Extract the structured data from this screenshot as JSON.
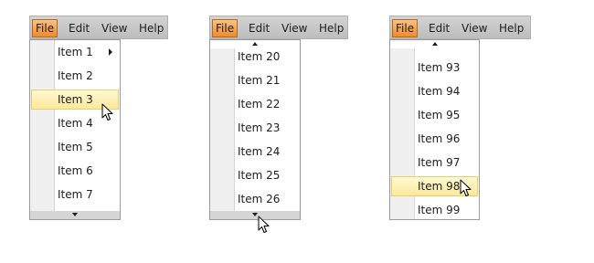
{
  "menubar": {
    "file": "File",
    "edit": "Edit",
    "view": "View",
    "help": "Help"
  },
  "demo1": {
    "items": [
      "Item 1",
      "Item 2",
      "Item 3",
      "Item 4",
      "Item 5",
      "Item 6",
      "Item 7"
    ],
    "highlighted": "Item 3",
    "has_submenu": "Item 1"
  },
  "demo2": {
    "items": [
      "Item 20",
      "Item 21",
      "Item 22",
      "Item 23",
      "Item 24",
      "Item 25",
      "Item 26"
    ]
  },
  "demo3": {
    "items": [
      "Item 93",
      "Item 94",
      "Item 95",
      "Item 96",
      "Item 97",
      "Item 98",
      "Item 99"
    ],
    "highlighted": "Item 98"
  },
  "colors": {
    "active_menu": "#f08a2c",
    "highlight": "#fce99b",
    "menubar": "#c8c8c8"
  },
  "icons": [
    "submenu-arrow-icon",
    "scroll-up-arrow-icon",
    "scroll-down-arrow-icon",
    "mouse-cursor-icon"
  ]
}
